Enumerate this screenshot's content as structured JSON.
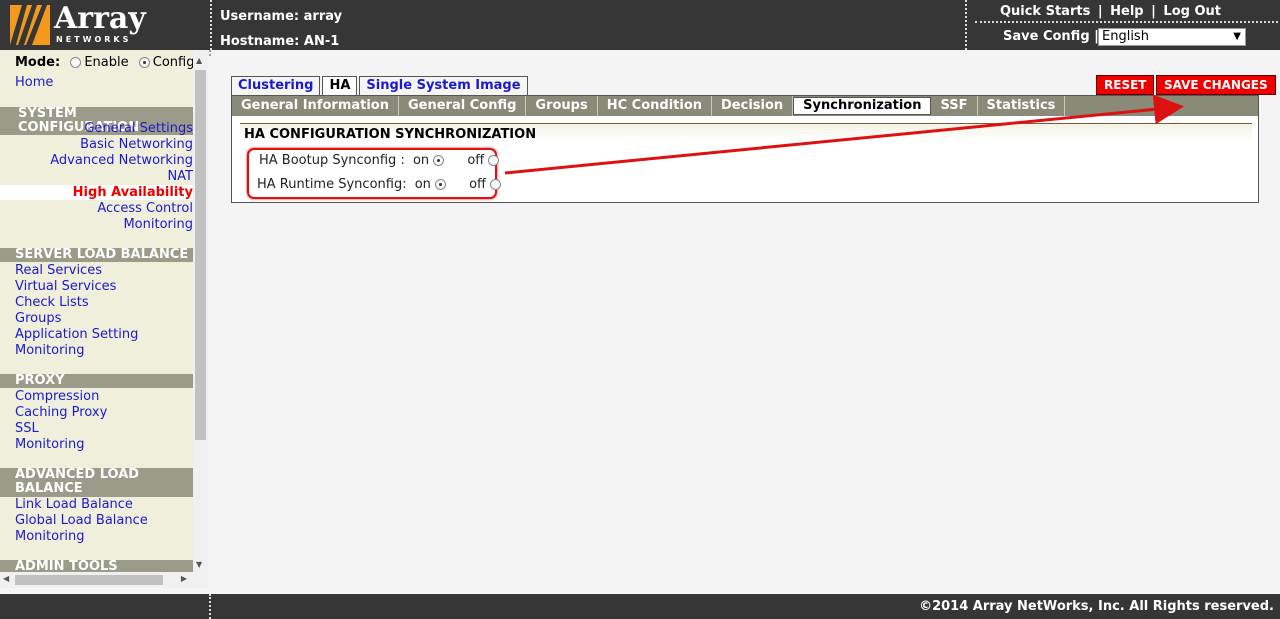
{
  "header": {
    "brand": "Array",
    "brand_sub": "NETWORKS",
    "username": "Username: array",
    "hostname": "Hostname: AN-1",
    "quick_starts": "Quick Starts",
    "help": "Help",
    "logout": "Log Out",
    "sep": "|",
    "save_config": "Save Config |",
    "language": "English"
  },
  "sidebar": {
    "mode_label": "Mode:",
    "mode_enable": "Enable",
    "mode_config": "Config",
    "home": "Home",
    "system_configuration": {
      "title": "SYSTEM CONFIGURATION",
      "items": [
        "General Settings",
        "Basic Networking",
        "Advanced Networking",
        "NAT",
        "High Availability",
        "Access Control",
        "Monitoring"
      ]
    },
    "server_load_balance": {
      "title": "SERVER LOAD BALANCE",
      "items": [
        "Real Services",
        "Virtual Services",
        "Check Lists",
        "Groups",
        "Application Setting",
        "Monitoring"
      ]
    },
    "proxy": {
      "title": "PROXY",
      "items": [
        "Compression",
        "Caching Proxy",
        "SSL",
        "Monitoring"
      ]
    },
    "advanced_load_balance": {
      "title_line1": "ADVANCED LOAD",
      "title_line2": "BALANCE",
      "items": [
        "Link Load Balance",
        "Global Load Balance",
        "Monitoring"
      ]
    },
    "admin_tools": {
      "title": "ADMIN TOOLS"
    }
  },
  "main": {
    "tabs": [
      "Clustering",
      "HA",
      "Single System Image"
    ],
    "subtabs": [
      "General Information",
      "General Config",
      "Groups",
      "HC Condition",
      "Decision",
      "Synchronization",
      "SSF",
      "Statistics"
    ],
    "reset": "RESET",
    "save_changes": "SAVE CHANGES",
    "section_title": "HA CONFIGURATION SYNCHRONIZATION",
    "bootup_label": "HA Bootup Synconfig :",
    "runtime_label": "HA Runtime Synconfig:",
    "on": "on",
    "off": "off",
    "bootup_value": "on",
    "runtime_value": "on"
  },
  "footer": {
    "copyright": "©2014 Array NetWorks, Inc. All Rights reserved."
  },
  "colors": {
    "header_bg": "#363636",
    "sidebar_bg": "#efefdc",
    "section_head": "#9b9b89",
    "link": "#1a1acc",
    "active": "#ee0000",
    "subtab_bar": "#8a8a78",
    "annotation": "#dd1111"
  }
}
